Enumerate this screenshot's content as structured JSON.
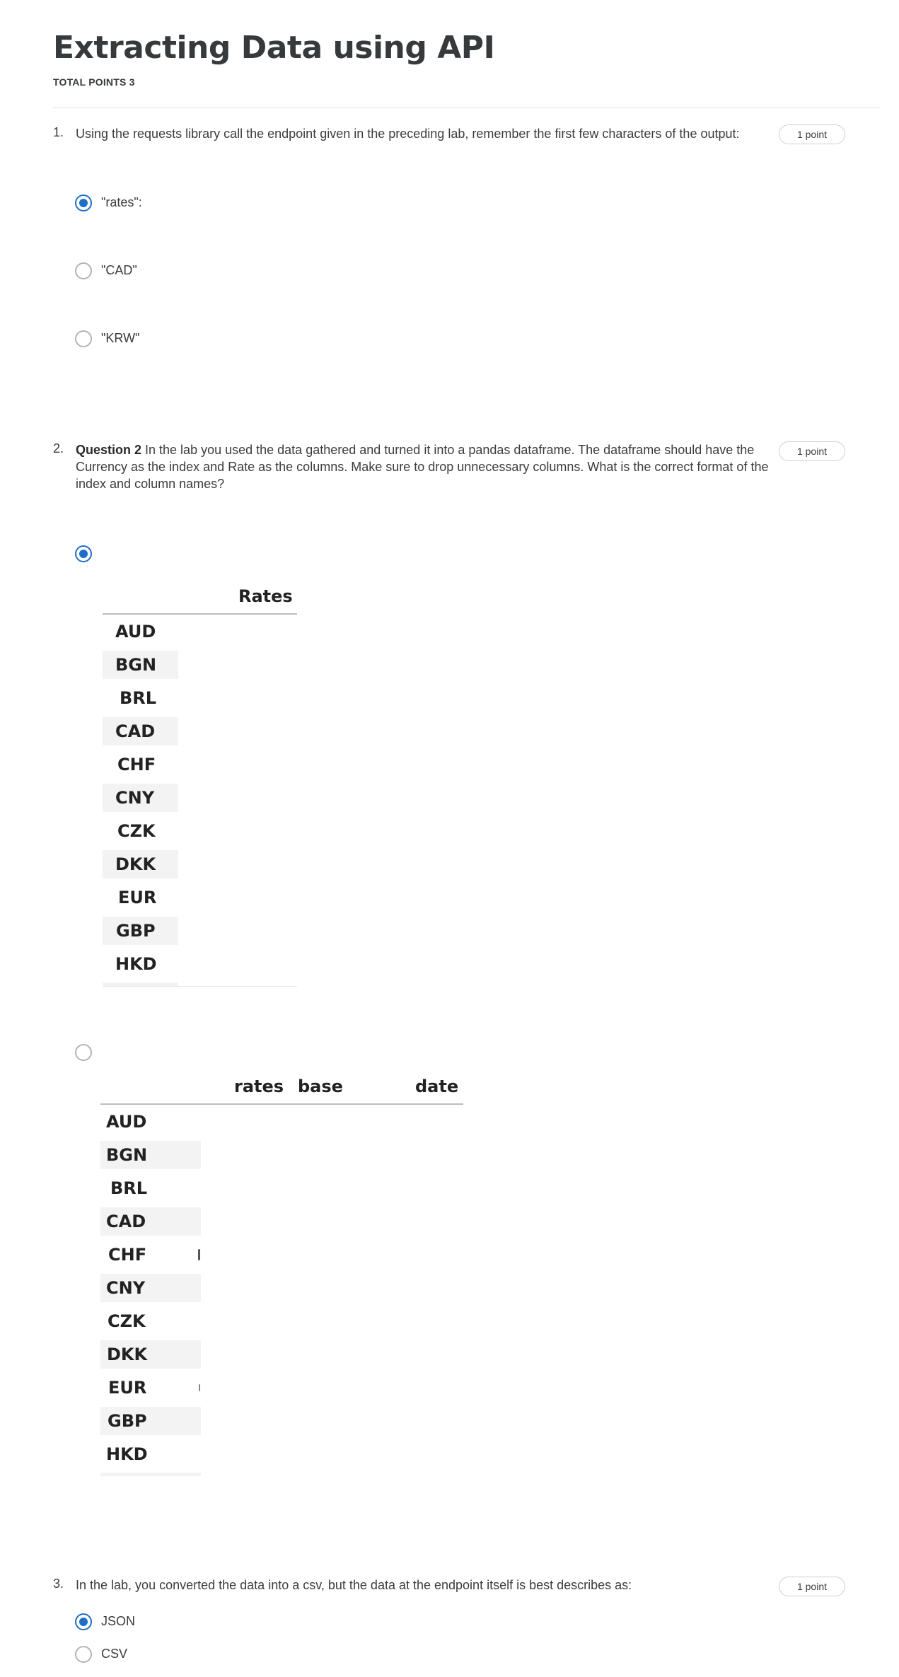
{
  "quiz": {
    "title": "Extracting Data using API",
    "total_points": "TOTAL POINTS 3"
  },
  "questions": [
    {
      "number": "1.",
      "text": "Using the requests library call the endpoint given in the preceding lab, remember the first few characters of the output:",
      "points": "1 point",
      "options": [
        {
          "label": "\"rates\":",
          "selected": true
        },
        {
          "label": "\"CAD\"",
          "selected": false
        },
        {
          "label": "\"KRW\"",
          "selected": false
        }
      ]
    },
    {
      "number": "2.",
      "lead": "Question 2",
      "text": " In the lab you used the data gathered and turned it into a pandas dataframe. The dataframe should have the Currency as the index and Rate as the columns. Make sure to drop unnecessary columns. What is the correct format of the index and column names?",
      "points": "1 point",
      "options": [
        {
          "selected": true,
          "table": {
            "columns": [
              "Rates"
            ],
            "index": [
              "AUD",
              "BGN",
              "BRL",
              "CAD",
              "CHF",
              "CNY",
              "CZK",
              "DKK",
              "EUR",
              "GBP",
              "HKD"
            ]
          }
        },
        {
          "selected": false,
          "table": {
            "columns": [
              "rates",
              "base",
              "date"
            ],
            "index": [
              "AUD",
              "BGN",
              "BRL",
              "CAD",
              "CHF",
              "CNY",
              "CZK",
              "DKK",
              "EUR",
              "GBP",
              "HKD"
            ]
          }
        }
      ]
    },
    {
      "number": "3.",
      "text": "In the lab, you converted the data into a csv, but the data at the endpoint itself is best describes as:",
      "points": "1 point",
      "options": [
        {
          "label": "JSON",
          "selected": true
        },
        {
          "label": "CSV",
          "selected": false
        }
      ]
    }
  ],
  "colors": {
    "accent": "#1f6fc5",
    "text": "#3c3c3c",
    "row_shade": "#f3f3f3"
  }
}
